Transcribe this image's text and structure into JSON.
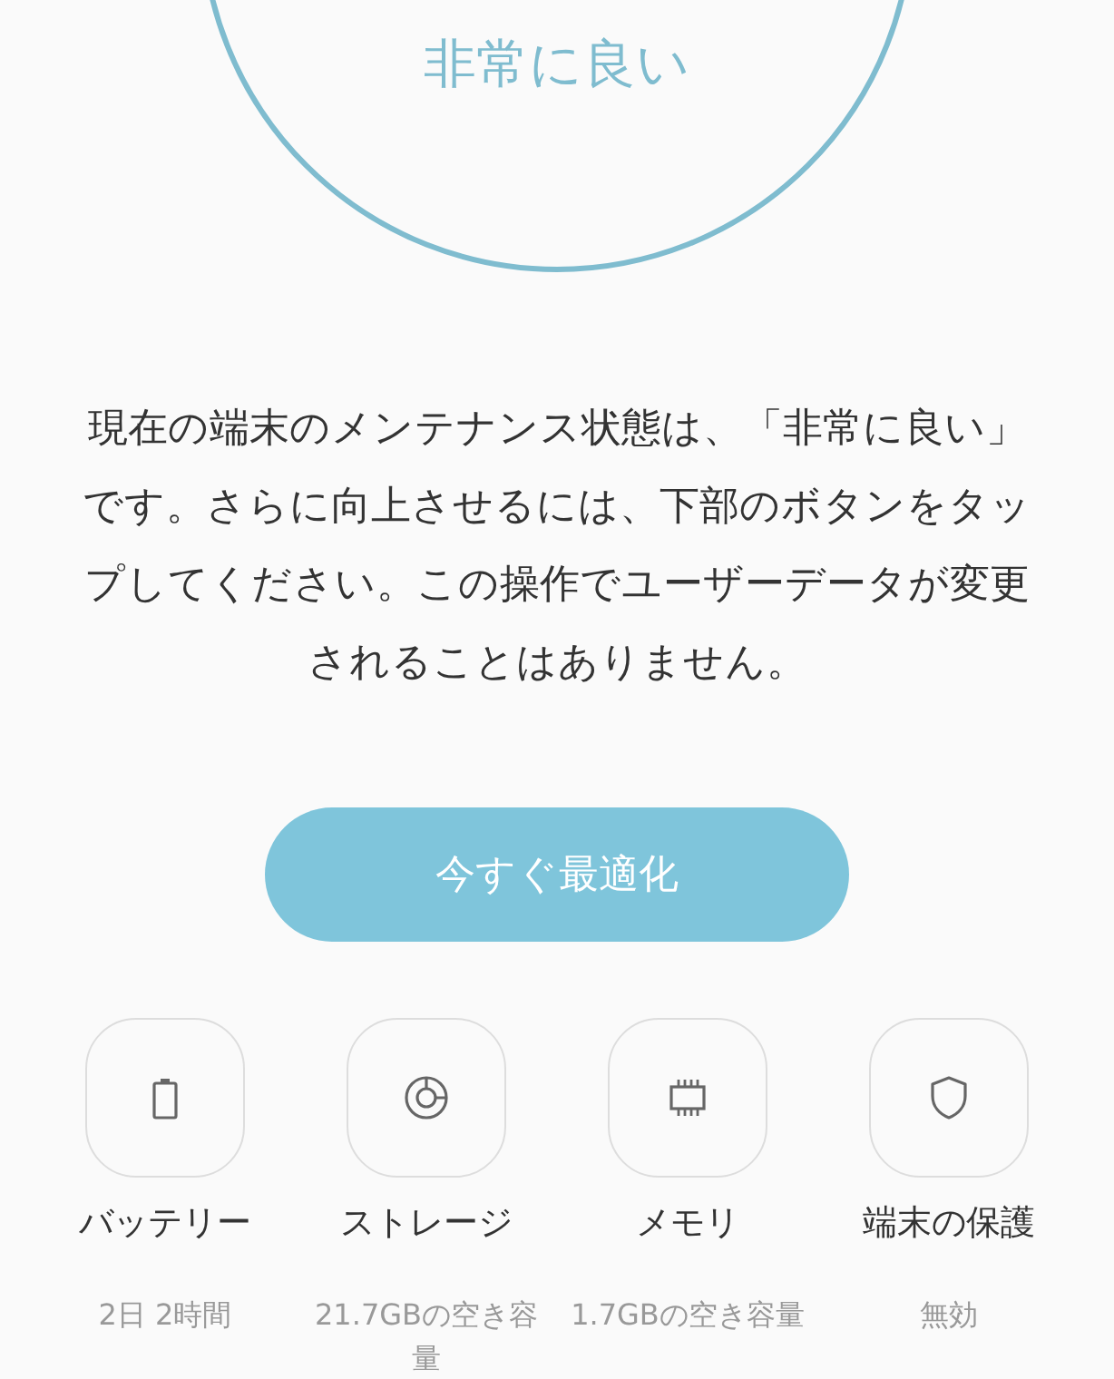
{
  "score": {
    "label": "非常に良い"
  },
  "description": "現在の端末のメンテナンス状態は、「非常に良い」です。さらに向上させるには、下部のボタンをタップしてください。この操作でユーザーデータが変更されることはありません。",
  "optimize_button": {
    "label": "今すぐ最適化"
  },
  "categories": [
    {
      "kind": "battery",
      "label": "バッテリー",
      "value": "2日 2時間"
    },
    {
      "kind": "storage",
      "label": "ストレージ",
      "value": "21.7GBの空き容量"
    },
    {
      "kind": "memory",
      "label": "メモリ",
      "value": "1.7GBの空き容量"
    },
    {
      "kind": "security",
      "label": "端末の保護",
      "value": "無効"
    }
  ]
}
